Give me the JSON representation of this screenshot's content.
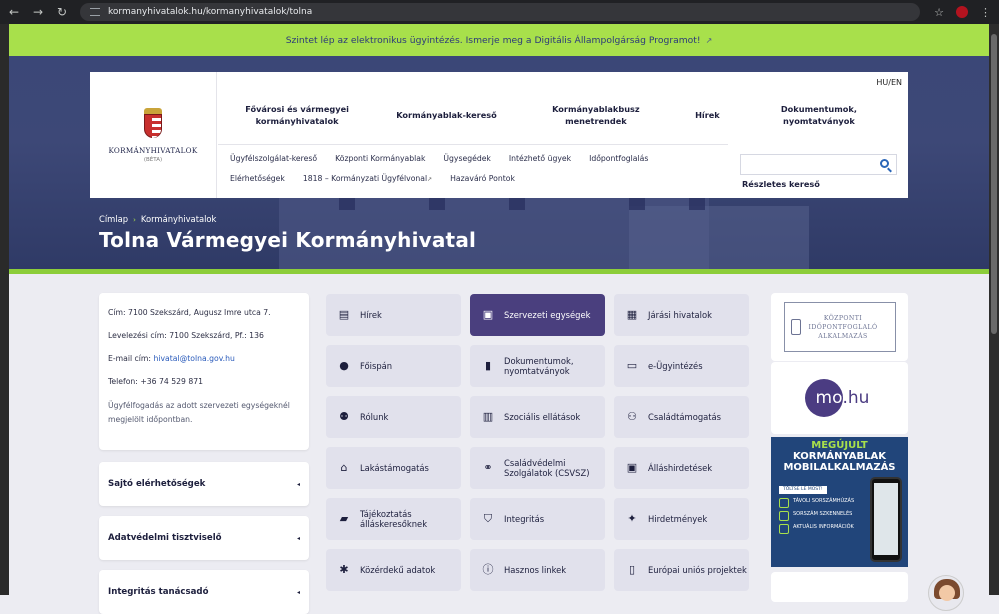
{
  "browser": {
    "url": "kormanyhivatalok.hu/kormanyhivatalok/tolna",
    "back": "←",
    "forward": "→",
    "reload": "↻",
    "star": "☆",
    "menu": "⋮"
  },
  "banner": {
    "text": "Szintet lép az elektronikus ügyintézés. Ismerje meg a Digitális Állampolgárság Programot!",
    "ext": "↗"
  },
  "logo": {
    "title": "KORMÁNYHIVATALOK",
    "sub": "(BÉTA)"
  },
  "lang": "HU/EN",
  "topnav": [
    "Fővárosi és vármegyei kormányhivatalok",
    "Kormányablak-kereső",
    "Kormányablakbusz menetrendek",
    "Hírek",
    "Dokumentumok, nyomtatványok"
  ],
  "subnav": [
    "Ügyfélszolgálat-kereső",
    "Központi Kormányablak",
    "Ügysegédek",
    "Intézhető ügyek",
    "Időpontfoglalás",
    "Elérhetőségek",
    "1818 – Kormányzati Ügyfélvonal",
    "Hazaváró Pontok"
  ],
  "search": {
    "placeholder": "",
    "detail": "Részletes kereső"
  },
  "breadcrumb": {
    "home": "Címlap",
    "sep": "›",
    "current": "Kormányhivatalok"
  },
  "page_title": "Tolna Vármegyei Kormányhivatal",
  "info": {
    "address_label": "Cím:",
    "address": "7100 Szekszárd, Augusz Imre utca 7.",
    "postal_label": "Levelezési cím:",
    "postal": "7100 Szekszárd, Pf.: 136",
    "email_label": "E-mail cím:",
    "email": "hivatal@tolna.gov.hu",
    "phone_label": "Telefon:",
    "phone": "+36 74 529 871",
    "note": "Ügyfélfogadás az adott szervezeti egységeknél megjelölt időpontban."
  },
  "accordions": [
    "Sajtó elérhetőségek",
    "Adatvédelmi tisztviselő",
    "Integritás tanácsadó"
  ],
  "caret": "◂",
  "tiles": [
    {
      "label": "Hírek",
      "icon": "▤"
    },
    {
      "label": "Szervezeti egységek",
      "icon": "▣"
    },
    {
      "label": "Járási hivatalok",
      "icon": "▦"
    },
    {
      "label": "Főispán",
      "icon": "●"
    },
    {
      "label": "Dokumentumok, nyomtatványok",
      "icon": "▮"
    },
    {
      "label": "e-Ügyintézés",
      "icon": "▭"
    },
    {
      "label": "Rólunk",
      "icon": "⚉"
    },
    {
      "label": "Szociális ellátások",
      "icon": "▥"
    },
    {
      "label": "Családtámogatás",
      "icon": "⚇"
    },
    {
      "label": "Lakástámogatás",
      "icon": "⌂"
    },
    {
      "label": "Családvédelmi Szolgálatok (CSVSZ)",
      "icon": "⚭"
    },
    {
      "label": "Álláshirdetések",
      "icon": "▣"
    },
    {
      "label": "Tájékoztatás álláskeresőknek",
      "icon": "▰"
    },
    {
      "label": "Integritás",
      "icon": "⛉"
    },
    {
      "label": "Hirdetmények",
      "icon": "✦"
    },
    {
      "label": "Közérdekű adatok",
      "icon": "✱"
    },
    {
      "label": "Hasznos linkek",
      "icon": "ⓘ"
    },
    {
      "label": "Európai uniós projektek",
      "icon": "▯"
    }
  ],
  "side": {
    "ko_line1": "KÖZPONTI",
    "ko_line2": "IDŐPONTFOGLALÓ",
    "ko_line3": "ALKALMAZÁS",
    "mo_a": "mo",
    "mo_b": ".hu",
    "app_h1": "MEGÚJULT",
    "app_h2": "KORMÁNYABLAK MOBILALKALMAZÁS",
    "app_btn": "TÖLTSE LE MOST!",
    "app_items": [
      "TÁVOLI SORSZÁMHÚZÁS",
      "SORSZÁM SZKENNELÉS",
      "AKTUÁLIS INFORMÁCIÓK"
    ]
  }
}
